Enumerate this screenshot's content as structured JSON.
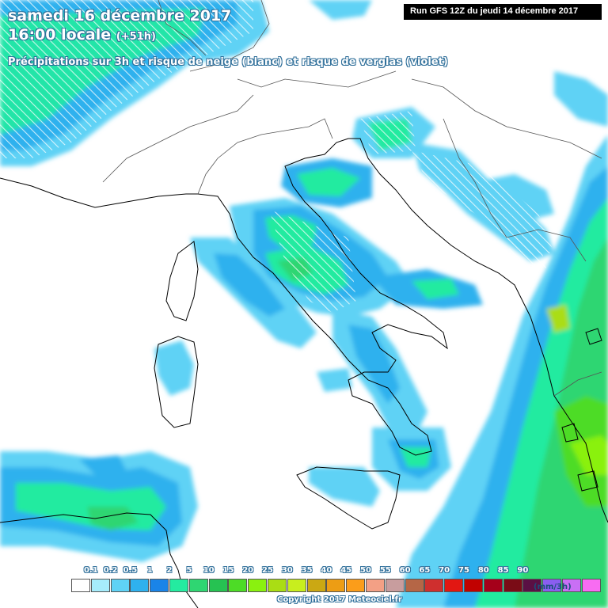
{
  "header": {
    "title_line1": "samedi 16 décembre 2017",
    "title_line2_time": "16:00 locale",
    "title_line2_offset": "(+51h)",
    "subtitle": "Précipitations sur 3h et risque de neige (blanc) et risque de verglas (violet)",
    "run_info": "Run GFS 12Z du jeudi 14 décembre 2017"
  },
  "legend": {
    "unit": "(mm/3h)",
    "tick_labels": [
      "0.1",
      "0.2",
      "0.5",
      "1",
      "2",
      "5",
      "10",
      "15",
      "20",
      "25",
      "30",
      "35",
      "40",
      "45",
      "50",
      "55",
      "60",
      "65",
      "70",
      "75",
      "80",
      "85",
      "90"
    ],
    "colors": [
      "#ffffff",
      "#a6ecfb",
      "#5fd2f5",
      "#2fb1ee",
      "#1a84e8",
      "#24eba0",
      "#2fd672",
      "#26c252",
      "#4ddc26",
      "#8af10f",
      "#aadd14",
      "#c8ee1e",
      "#cba813",
      "#ed9d14",
      "#fb9d1a",
      "#f3a085",
      "#c89d9e",
      "#b56646",
      "#cf2f2e",
      "#e21712",
      "#c10100",
      "#a5001a",
      "#7a0c16",
      "#5a1044",
      "#8a5ef0",
      "#c96ff5",
      "#f86cf2"
    ]
  },
  "footer": {
    "copyright": "Copyright 2017 Meteociel.fr"
  },
  "map_colors": {
    "precip_light": "#5fd2f5",
    "precip_mid": "#2fb1ee",
    "precip_dark": "#1a84e8",
    "precip_green": "#24eba0",
    "precip_green_dark": "#2fd672",
    "precip_yellowgreen": "#8af10f",
    "precip_olive": "#aadd14",
    "coastline": "#000000",
    "border": "#777777"
  }
}
